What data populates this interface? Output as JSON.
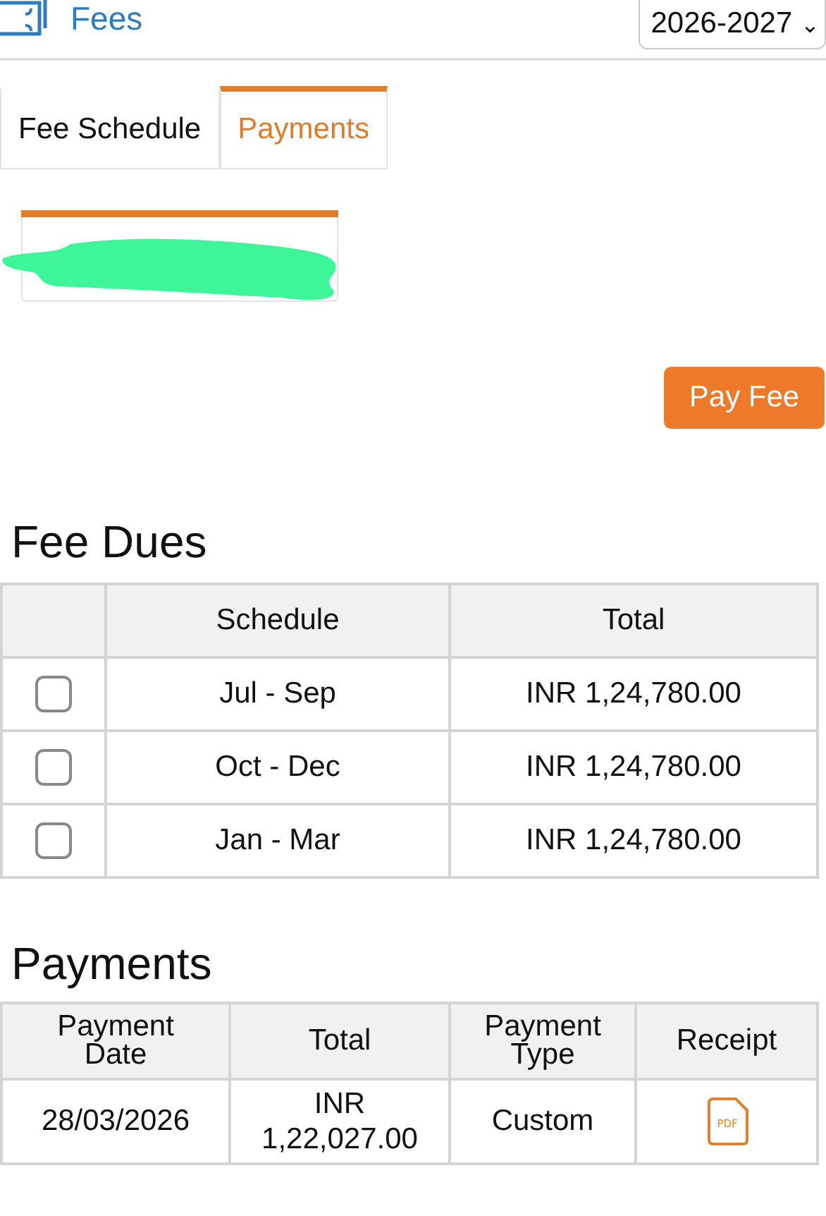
{
  "header": {
    "title": "Fees",
    "year_select": {
      "value": "2026-2027",
      "caret": "⌄"
    }
  },
  "tabs": [
    {
      "label": "Fee Schedule",
      "selected": false
    },
    {
      "label": "Payments",
      "selected": true
    }
  ],
  "pay_button": "Pay Fee",
  "fee_dues": {
    "title": "Fee Dues",
    "columns": [
      "",
      "Schedule",
      "Total"
    ],
    "rows": [
      {
        "checked": false,
        "schedule": "Jul - Sep",
        "total": "INR 1,24,780.00"
      },
      {
        "checked": false,
        "schedule": "Oct - Dec",
        "total": "INR 1,24,780.00"
      },
      {
        "checked": false,
        "schedule": "Jan - Mar",
        "total": "INR 1,24,780.00"
      }
    ]
  },
  "payments": {
    "title": "Payments",
    "columns": [
      "Payment Date",
      "Total",
      "Payment Type",
      "Receipt"
    ],
    "rows": [
      {
        "date": "28/03/2026",
        "total": "INR 1,22,027.00",
        "type": "Custom",
        "receipt_label": "PDF"
      }
    ]
  }
}
